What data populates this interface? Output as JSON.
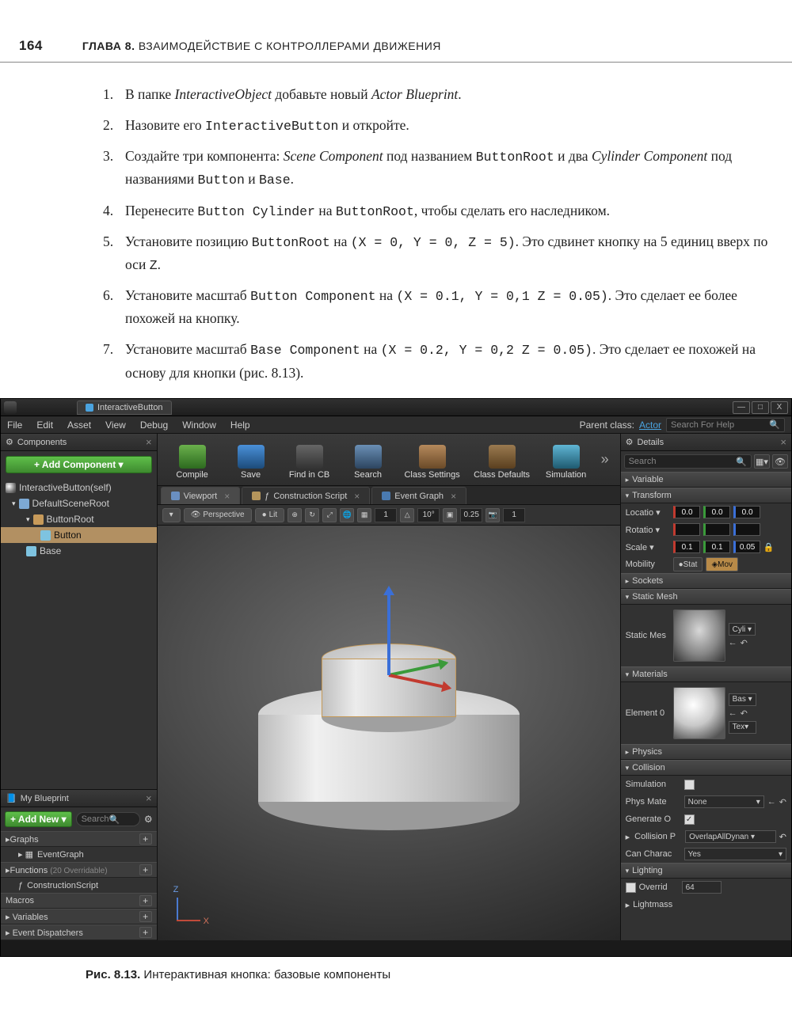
{
  "header": {
    "page_number": "164",
    "chapter_bold": "ГЛАВА 8.",
    "chapter_rest": " ВЗАИМОДЕЙСТВИЕ С КОНТРОЛЛЕРАМИ ДВИЖЕНИЯ"
  },
  "steps": [
    {
      "pre": "В папке ",
      "em1": "InteractiveObject",
      "mid": " добавьте новый ",
      "em2": "Actor Blueprint",
      "post": "."
    },
    {
      "pre": "Назовите его ",
      "mono1": "InteractiveButton",
      "post": " и откройте."
    },
    {
      "pre": "Создайте три компонента: ",
      "em1": "Scene Component",
      "mid": " под названием ",
      "mono1": "ButtonRoot",
      "mid2": " и два ",
      "em2": "Cylinder Component",
      "mid3": " под названиями ",
      "mono2": "Button",
      "mid4": " и ",
      "mono3": "Base",
      "post": "."
    },
    {
      "pre": "Перенесите ",
      "mono1": "Button Cylinder",
      "mid": " на ",
      "mono2": "ButtonRoot",
      "post": ", чтобы сделать его наследником."
    },
    {
      "pre": "Установите позицию ",
      "mono1": "ButtonRoot",
      "mid": " на ",
      "mono2": "(X = 0, Y = 0, Z = 5)",
      "post": ". Это сдвинет кнопку на 5 единиц вверх по оси ",
      "mono3": "Z",
      "post2": "."
    },
    {
      "pre": "Установите масштаб ",
      "mono1": "Button Component",
      "mid": " на ",
      "mono2": "(X = 0.1, Y = 0,1 Z = 0.05)",
      "post": ". Это сделает ее более похожей на кнопку."
    },
    {
      "pre": "Установите масштаб ",
      "mono1": "Base Component",
      "mid": " на ",
      "mono2": "(X = 0.2, Y = 0,2 Z = 0.05)",
      "post": ". Это сделает ее похожей на основу для кнопки (рис. 8.13)."
    }
  ],
  "figure_caption": {
    "bold": "Рис. 8.13.",
    "rest": " Интерактивная кнопка: базовые компоненты"
  },
  "editor": {
    "tab_title": "InteractiveButton",
    "window_buttons": [
      "—",
      "□",
      "X"
    ],
    "menu": [
      "File",
      "Edit",
      "Asset",
      "View",
      "Debug",
      "Window",
      "Help"
    ],
    "parent_class_label": "Parent class:",
    "parent_class_value": "Actor",
    "search_help_placeholder": "Search For Help",
    "components_panel": {
      "title": "Components",
      "add_btn": "+ Add Component ▾",
      "tree": [
        {
          "label": "InteractiveButton(self)",
          "lvl": 0,
          "icon": "ic-sphere"
        },
        {
          "label": "DefaultSceneRoot",
          "lvl": 1,
          "icon": "ic-scene",
          "exp": true
        },
        {
          "label": "ButtonRoot",
          "lvl": 2,
          "icon": "ic-root",
          "exp": true
        },
        {
          "label": "Button",
          "lvl": 3,
          "icon": "ic-mesh",
          "sel": true
        },
        {
          "label": "Base",
          "lvl": 2,
          "icon": "ic-mesh"
        }
      ]
    },
    "my_blueprint": {
      "title": "My Blueprint",
      "add_btn": "+ Add New ▾",
      "search_placeholder": "Search",
      "cats": [
        {
          "name": "Graphs",
          "children": [
            {
              "label": "EventGraph"
            }
          ]
        },
        {
          "name": "Functions",
          "extra": "(20 Overridable)",
          "children": [
            {
              "label": "ConstructionScript"
            }
          ]
        },
        {
          "name": "Macros"
        },
        {
          "name": "Variables"
        },
        {
          "name": "Event Dispatchers"
        }
      ]
    },
    "toolbar": [
      "Compile",
      "Save",
      "Find in CB",
      "Search",
      "Class Settings",
      "Class Defaults",
      "Simulation"
    ],
    "editor_tabs": [
      {
        "label": "Viewport",
        "active": true,
        "icon": "ei-vp"
      },
      {
        "label": "Construction Script",
        "icon": "ei-cs"
      },
      {
        "label": "Event Graph",
        "icon": "ei-eg"
      }
    ],
    "vp_toolbar": {
      "perspective": "Perspective",
      "lit": "Lit",
      "snap_deg": "10°",
      "snap_loc": "0.25"
    },
    "details": {
      "title": "Details",
      "search_placeholder": "Search",
      "variable_section": "Variable",
      "transform": {
        "title": "Transform",
        "location": {
          "label": "Locatio ▾",
          "x": "0.0",
          "y": "0.0",
          "z": "0.0"
        },
        "rotation": {
          "label": "Rotatio ▾"
        },
        "scale": {
          "label": "Scale ▾",
          "x": "0.1",
          "y": "0.1",
          "z": "0.05"
        },
        "mobility": {
          "label": "Mobility",
          "static": "Stat",
          "movable": "Mov"
        }
      },
      "sockets": "Sockets",
      "static_mesh": {
        "title": "Static Mesh",
        "label": "Static Mes",
        "value": "Cyli ▾"
      },
      "materials": {
        "title": "Materials",
        "label": "Element 0",
        "value": "Bas ▾",
        "tex": "Tex▾"
      },
      "physics": "Physics",
      "collision": {
        "title": "Collision",
        "simulation": "Simulation",
        "phys_mat": {
          "label": "Phys Mate",
          "value": "None"
        },
        "generate": {
          "label": "Generate O",
          "checked": true
        },
        "preset": {
          "label": "Collision P",
          "value": "OverlapAllDynan ▾"
        },
        "can_char": {
          "label": "Can Charac",
          "value": "Yes"
        }
      },
      "lighting": {
        "title": "Lighting",
        "override": {
          "label": "Overrid",
          "value": "64"
        },
        "lightmass": "Lightmass"
      }
    }
  }
}
